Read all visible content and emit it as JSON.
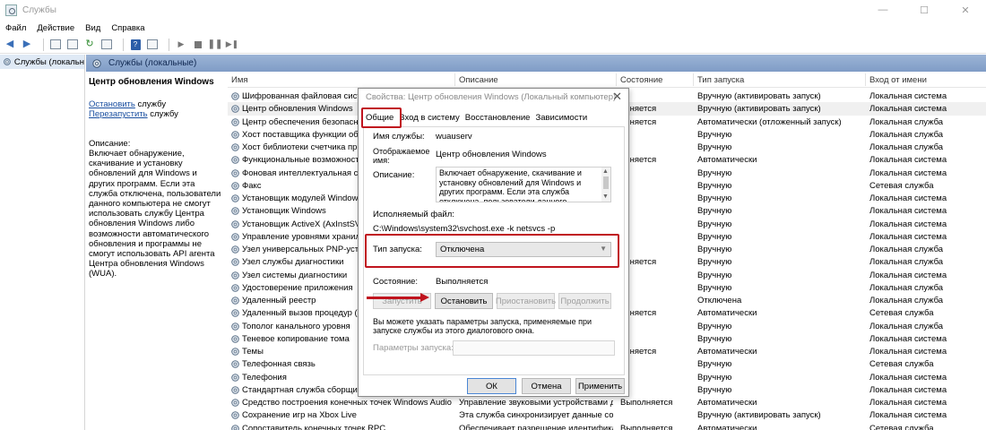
{
  "window": {
    "title": "Службы",
    "minimize": "—",
    "maximize": "☐",
    "close": "✕"
  },
  "menu": [
    "Файл",
    "Действие",
    "Вид",
    "Справка"
  ],
  "tree": {
    "item": "Службы (локальн"
  },
  "pane_header": "Службы (локальные)",
  "desc": {
    "title": "Центр обновления Windows",
    "stop_link": "Остановить",
    "stop_suffix": " службу",
    "restart_link": "Перезапустить",
    "restart_suffix": " службу",
    "label": "Описание:",
    "text": "Включает обнаружение, скачивание и установку обновлений для Windows и других программ. Если эта служба отключена, пользователи данного компьютера не смогут использовать службу Центра обновления Windows либо возможности автоматического обновления и программы не смогут использовать API агента Центра обновления Windows (WUA)."
  },
  "columns": [
    "Имя",
    "Описание",
    "Состояние",
    "Тип запуска",
    "Вход от имени"
  ],
  "rows": [
    [
      "Шифрованная файловая система",
      "",
      "",
      "Вручную (активировать запуск)",
      "Локальная система"
    ],
    [
      "Центр обновления Windows",
      "",
      "олняется",
      "Вручную (активировать запуск)",
      "Локальная система"
    ],
    [
      "Центр обеспечения безопасност",
      "",
      "олняется",
      "Автоматически (отложенный запуск)",
      "Локальная служба"
    ],
    [
      "Хост поставщика функции обнар",
      "",
      "",
      "Вручную",
      "Локальная служба"
    ],
    [
      "Хост библиотеки счетчика прои",
      "",
      "",
      "Вручную",
      "Локальная служба"
    ],
    [
      "Функциональные возможности д",
      "",
      "олняется",
      "Автоматически",
      "Локальная система"
    ],
    [
      "Фоновая интеллектуальная служ",
      "",
      "",
      "Вручную",
      "Локальная система"
    ],
    [
      "Факс",
      "",
      "",
      "Вручную",
      "Сетевая служба"
    ],
    [
      "Установщик модулей Windows",
      "",
      "",
      "Вручную",
      "Локальная система"
    ],
    [
      "Установщик Windows",
      "",
      "",
      "Вручную",
      "Локальная система"
    ],
    [
      "Установщик ActiveX (AxInstSV)",
      "",
      "",
      "Вручную",
      "Локальная система"
    ],
    [
      "Управление уровнями хранилищ",
      "",
      "",
      "Вручную",
      "Локальная система"
    ],
    [
      "Узел универсальных PNP-устрой",
      "",
      "",
      "Вручную",
      "Локальная служба"
    ],
    [
      "Узел службы диагностики",
      "",
      "олняется",
      "Вручную",
      "Локальная служба"
    ],
    [
      "Узел системы диагностики",
      "",
      "",
      "Вручную",
      "Локальная система"
    ],
    [
      "Удостоверение приложения",
      "",
      "",
      "Вручную",
      "Локальная служба"
    ],
    [
      "Удаленный реестр",
      "",
      "",
      "Отключена",
      "Локальная служба"
    ],
    [
      "Удаленный вызов процедур (RPC",
      "",
      "олняется",
      "Автоматически",
      "Сетевая служба"
    ],
    [
      "Тополог канального уровня",
      "",
      "",
      "Вручную",
      "Локальная служба"
    ],
    [
      "Теневое копирование тома",
      "",
      "",
      "Вручную",
      "Локальная система"
    ],
    [
      "Темы",
      "",
      "олняется",
      "Автоматически",
      "Локальная система"
    ],
    [
      "Телефонная связь",
      "",
      "",
      "Вручную",
      "Сетевая служба"
    ],
    [
      "Телефония",
      "",
      "",
      "Вручную",
      "Локальная система"
    ],
    [
      "Стандартная служба сборщика ц",
      "",
      "",
      "Вручную",
      "Локальная система"
    ],
    [
      "Средство построения конечных точек Windows Audio",
      "Управление звуковыми устройствами для ...",
      "Выполняется",
      "Автоматически",
      "Локальная система"
    ],
    [
      "Сохранение игр на Xbox Live",
      "Эта служба синхронизирует данные сохран...",
      "",
      "Вручную (активировать запуск)",
      "Локальная система"
    ],
    [
      "Сопоставитель конечных точек RPC",
      "Обеспечивает разрешение идентификато...",
      "Выполняется",
      "Автоматически",
      "Сетевая служба"
    ]
  ],
  "dialog": {
    "title": "Свойства: Центр обновления Windows (Локальный компьютер)",
    "close": "✕",
    "tabs": [
      "Общие",
      "Вход в систему",
      "Восстановление",
      "Зависимости"
    ],
    "service_name_label": "Имя службы:",
    "service_name": "wuauserv",
    "display_name_label": "Отображаемое имя:",
    "display_name": "Центр обновления Windows",
    "description_label": "Описание:",
    "description": "Включает обнаружение, скачивание и установку обновлений для Windows и других программ. Если эта служба отключена, пользователи данного компьютера не смогут",
    "exe_label": "Исполняемый файл:",
    "exe_path": "C:\\Windows\\system32\\svchost.exe -k netsvcs -p",
    "startup_label": "Тип запуска:",
    "startup_value": "Отключена",
    "state_label": "Состояние:",
    "state_value": "Выполняется",
    "btn_start": "Запустить",
    "btn_stop": "Остановить",
    "btn_pause": "Приостановить",
    "btn_resume": "Продолжить",
    "hint": "Вы можете указать параметры запуска, применяемые при запуске службы из этого диалогового окна.",
    "params_label": "Параметры запуска:",
    "ok": "ОК",
    "cancel": "Отмена",
    "apply": "Применить"
  },
  "colors": {
    "annotation": "#c0141e",
    "header_blue": "#8fa8cf",
    "link": "#1a4fa0"
  }
}
